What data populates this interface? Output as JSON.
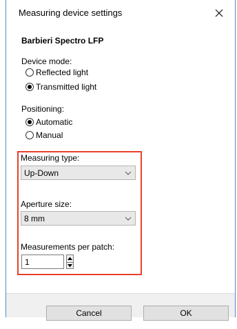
{
  "dialog": {
    "title": "Measuring device settings",
    "close_icon": "close-icon",
    "device_name": "Barbieri Spectro LFP"
  },
  "device_mode": {
    "label": "Device mode:",
    "options": [
      {
        "label": "Reflected light",
        "checked": false
      },
      {
        "label": "Transmitted light",
        "checked": true
      }
    ]
  },
  "positioning": {
    "label": "Positioning:",
    "options": [
      {
        "label": "Automatic",
        "checked": true
      },
      {
        "label": "Manual",
        "checked": false
      }
    ]
  },
  "measuring_type": {
    "label": "Measuring type:",
    "value": "Up-Down",
    "icon": "chevron-down-icon"
  },
  "aperture_size": {
    "label": "Aperture size:",
    "value": "8 mm",
    "icon": "chevron-down-icon"
  },
  "measurements_per_patch": {
    "label": "Measurements per patch:",
    "value": "1",
    "up_icon": "spin-up-icon",
    "down_icon": "spin-down-icon"
  },
  "buttons": {
    "cancel": "Cancel",
    "ok": "OK"
  },
  "colors": {
    "highlight": "#e8402a",
    "window_border": "#4a8fd6",
    "combo_bg": "#e8e8e8",
    "footer_bg": "#f0f0f0"
  }
}
